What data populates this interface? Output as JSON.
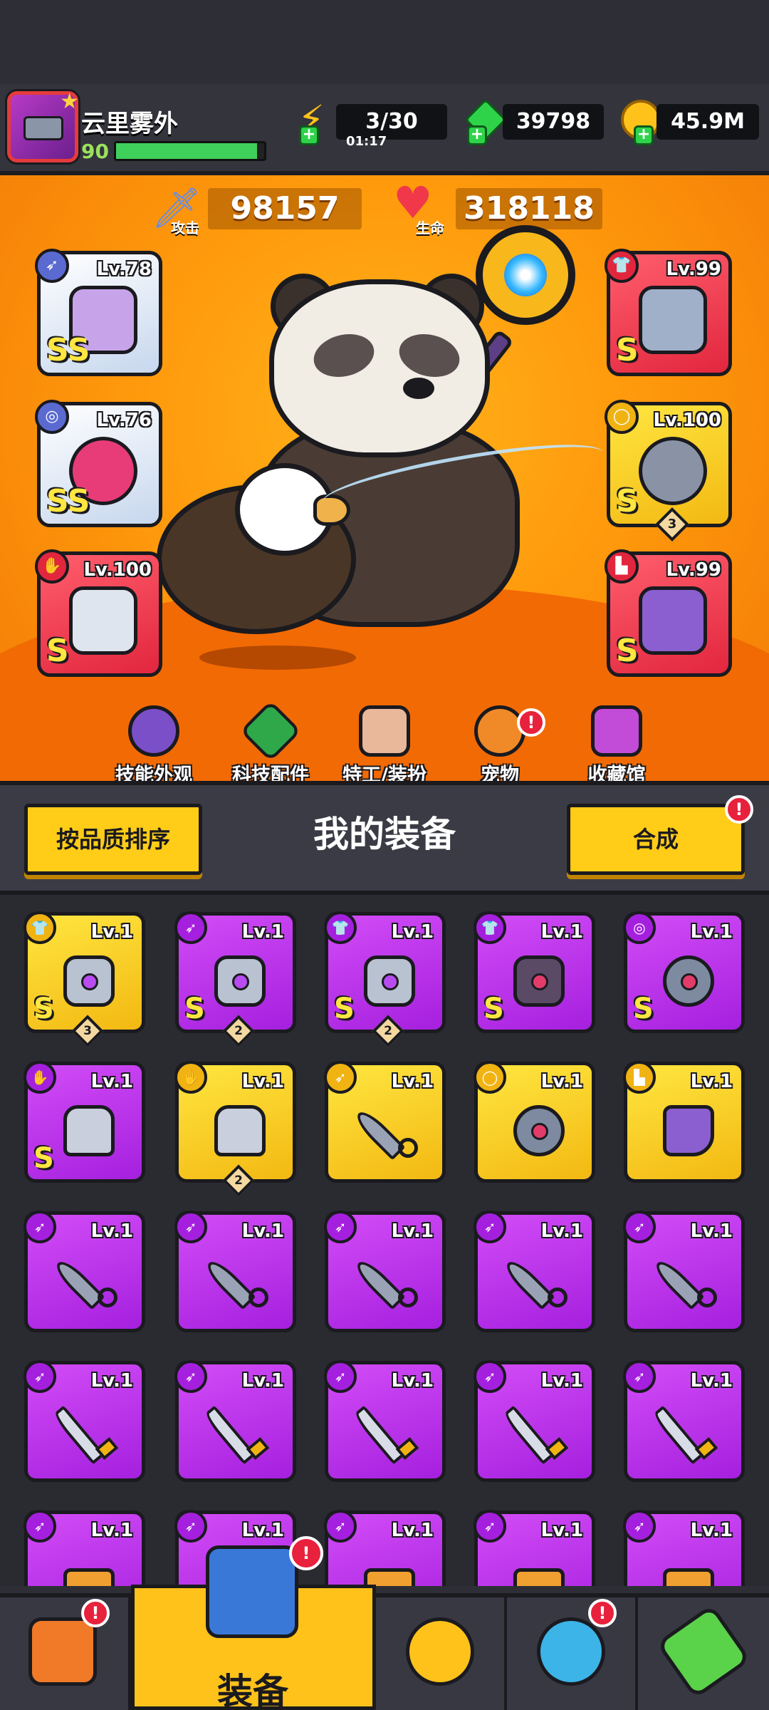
{
  "header": {
    "player_name": "云里雾外",
    "level": "90",
    "xp_fraction": 0.95,
    "energy": "3/30",
    "energy_timer": "01:17",
    "gems": "39798",
    "coins": "45.9M"
  },
  "stats": {
    "attack_label": "攻击",
    "attack_value": "98157",
    "hp_label": "生命",
    "hp_value": "318118"
  },
  "equipped": {
    "weapon": {
      "level": "Lv.78",
      "grade": "SS",
      "icon": "staff-icon"
    },
    "necklace": {
      "level": "Lv.76",
      "grade": "SS",
      "icon": "necklace-icon"
    },
    "gloves": {
      "level": "Lv.100",
      "grade": "S",
      "icon": "glove-icon"
    },
    "armor": {
      "level": "Lv.99",
      "grade": "S",
      "icon": "armor-icon"
    },
    "belt": {
      "level": "Lv.100",
      "grade": "S",
      "icon": "belt-icon",
      "stack": "3"
    },
    "boots": {
      "level": "Lv.99",
      "grade": "S",
      "icon": "boots-icon"
    }
  },
  "menu": [
    {
      "label": "技能外观",
      "icon": "skill-skin-icon",
      "badge": false
    },
    {
      "label": "科技配件",
      "icon": "tech-parts-icon",
      "badge": false
    },
    {
      "label": "特工/装扮",
      "icon": "agent-costume-icon",
      "badge": false
    },
    {
      "label": "宠物",
      "icon": "pet-icon",
      "badge": true
    },
    {
      "label": "收藏馆",
      "icon": "collection-icon",
      "badge": false
    }
  ],
  "toolbar": {
    "sort_label": "按品质排序",
    "title": "我的装备",
    "merge_label": "合成",
    "badge": "!"
  },
  "inventory": [
    {
      "level": "Lv.1",
      "color": "gold",
      "cat": "armor",
      "grade": "S",
      "stack": "3",
      "item": "armor"
    },
    {
      "level": "Lv.1",
      "color": "purple",
      "cat": "weapon",
      "grade": "S",
      "stack": "2",
      "item": "spiked-sword"
    },
    {
      "level": "Lv.1",
      "color": "purple",
      "cat": "armor",
      "grade": "S",
      "stack": "2",
      "item": "armor"
    },
    {
      "level": "Lv.1",
      "color": "purple",
      "cat": "armor",
      "grade": "S",
      "stack": "",
      "item": "dark-armor"
    },
    {
      "level": "Lv.1",
      "color": "purple",
      "cat": "necklace",
      "grade": "S",
      "stack": "",
      "item": "chain-necklace"
    },
    {
      "level": "Lv.1",
      "color": "purple",
      "cat": "glove",
      "grade": "S",
      "stack": "",
      "item": "gauntlet"
    },
    {
      "level": "Lv.1",
      "color": "gold",
      "cat": "glove",
      "grade": "",
      "stack": "2",
      "item": "gauntlet"
    },
    {
      "level": "Lv.1",
      "color": "gold",
      "cat": "weapon",
      "grade": "",
      "stack": "",
      "item": "kunai"
    },
    {
      "level": "Lv.1",
      "color": "gold",
      "cat": "belt",
      "grade": "",
      "stack": "",
      "item": "belt"
    },
    {
      "level": "Lv.1",
      "color": "gold",
      "cat": "boots",
      "grade": "",
      "stack": "",
      "item": "boots"
    },
    {
      "level": "Lv.1",
      "color": "purple",
      "cat": "weapon",
      "grade": "",
      "stack": "",
      "item": "kunai"
    },
    {
      "level": "Lv.1",
      "color": "purple",
      "cat": "weapon",
      "grade": "",
      "stack": "",
      "item": "kunai"
    },
    {
      "level": "Lv.1",
      "color": "purple",
      "cat": "weapon",
      "grade": "",
      "stack": "",
      "item": "kunai"
    },
    {
      "level": "Lv.1",
      "color": "purple",
      "cat": "weapon",
      "grade": "",
      "stack": "",
      "item": "kunai"
    },
    {
      "level": "Lv.1",
      "color": "purple",
      "cat": "weapon",
      "grade": "",
      "stack": "",
      "item": "kunai"
    },
    {
      "level": "Lv.1",
      "color": "purple",
      "cat": "weapon",
      "grade": "",
      "stack": "",
      "item": "katana"
    },
    {
      "level": "Lv.1",
      "color": "purple",
      "cat": "weapon",
      "grade": "",
      "stack": "",
      "item": "katana"
    },
    {
      "level": "Lv.1",
      "color": "purple",
      "cat": "weapon",
      "grade": "",
      "stack": "",
      "item": "katana"
    },
    {
      "level": "Lv.1",
      "color": "purple",
      "cat": "weapon",
      "grade": "",
      "stack": "",
      "item": "katana"
    },
    {
      "level": "Lv.1",
      "color": "purple",
      "cat": "weapon",
      "grade": "",
      "stack": "",
      "item": "katana"
    },
    {
      "level": "Lv.1",
      "color": "purple",
      "cat": "weapon",
      "grade": "",
      "stack": "",
      "item": "revolver"
    },
    {
      "level": "Lv.1",
      "color": "purple",
      "cat": "weapon",
      "grade": "",
      "stack": "",
      "item": "revolver"
    },
    {
      "level": "Lv.1",
      "color": "purple",
      "cat": "weapon",
      "grade": "",
      "stack": "",
      "item": "shotgun"
    },
    {
      "level": "Lv.1",
      "color": "purple",
      "cat": "weapon",
      "grade": "",
      "stack": "",
      "item": "bazooka"
    },
    {
      "level": "Lv.1",
      "color": "purple",
      "cat": "weapon",
      "grade": "",
      "stack": "",
      "item": "bazooka"
    }
  ],
  "nav": {
    "shop_icon": "shop-icon",
    "equip_label": "装备",
    "talent_icon": "talent-star-icon",
    "planet_icon": "planet-icon",
    "lab_icon": "dna-icon"
  },
  "colors": {
    "gold": "#ffcc18",
    "purple": "#b53ae8",
    "red": "#e2263e",
    "orange_bg": "#ff9a0c"
  }
}
